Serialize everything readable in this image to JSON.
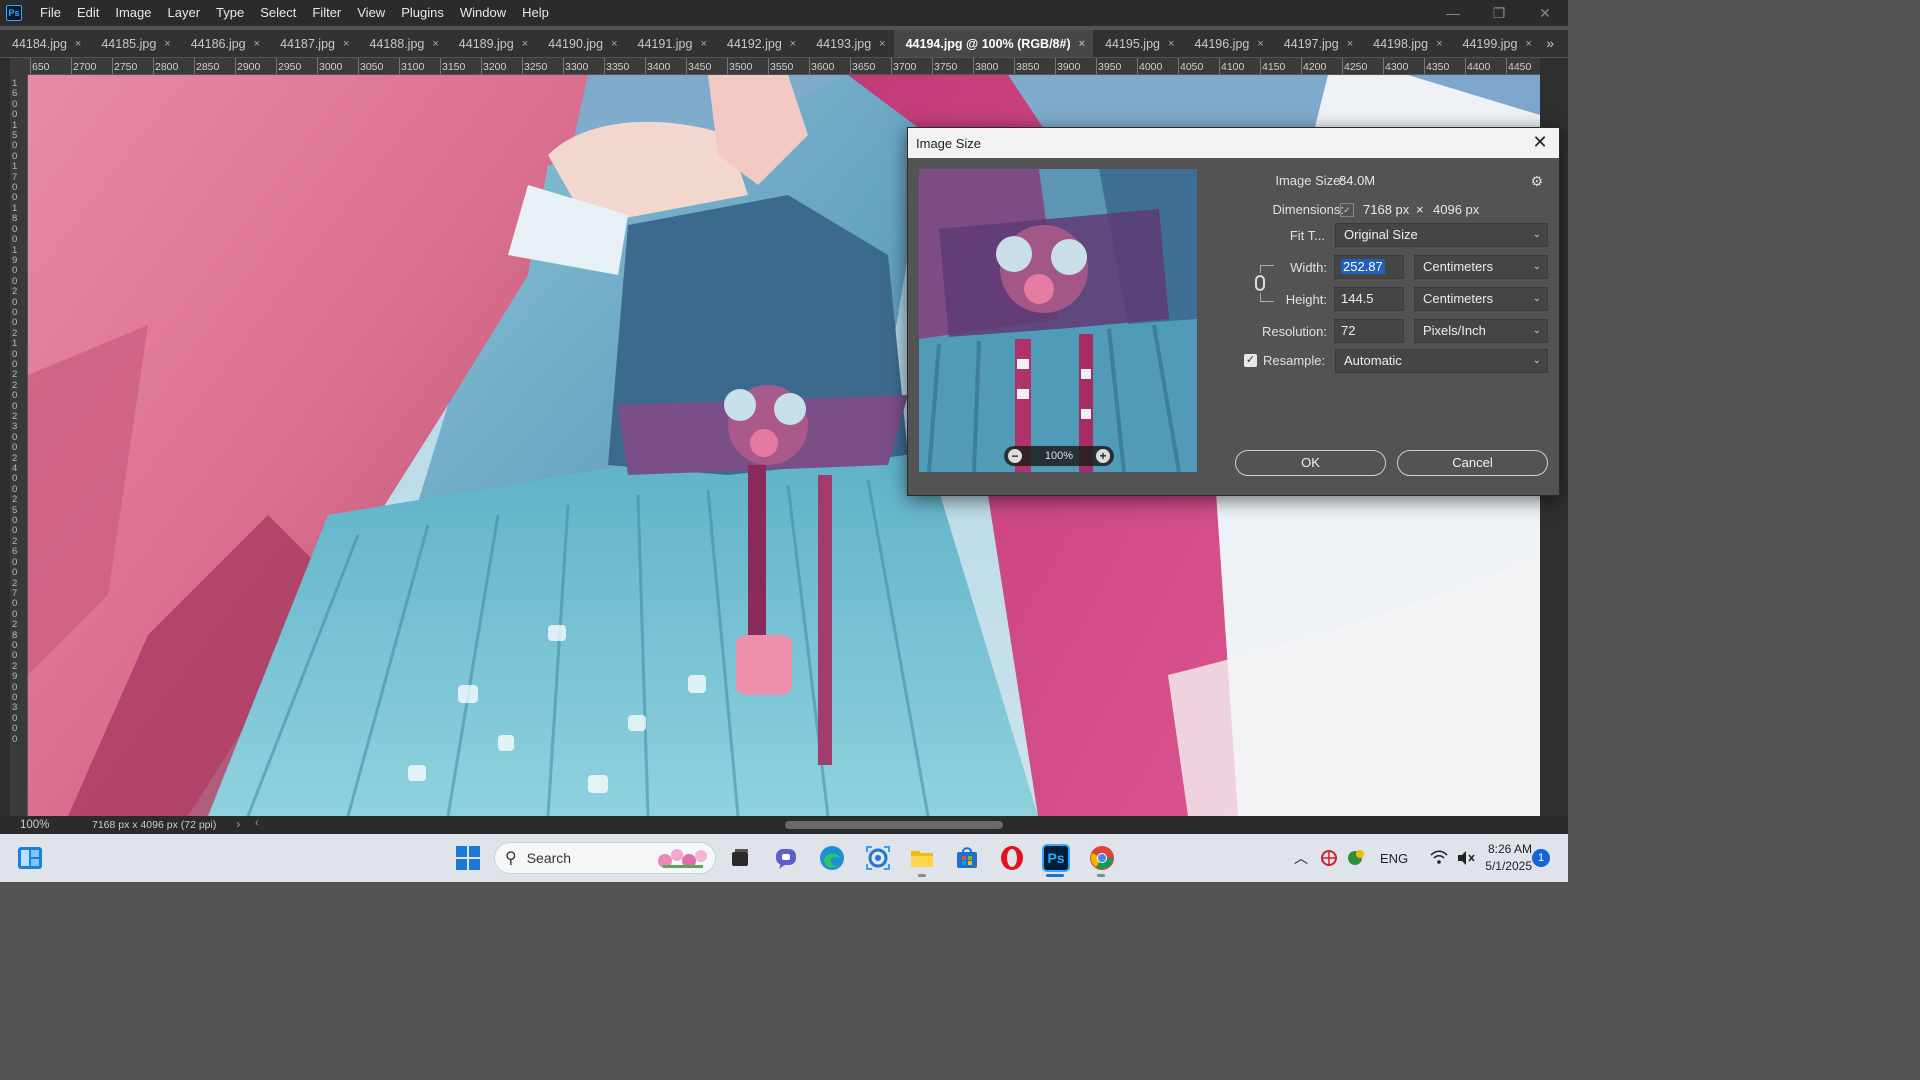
{
  "menu": {
    "logo": "Ps",
    "items": [
      "File",
      "Edit",
      "Image",
      "Layer",
      "Type",
      "Select",
      "Filter",
      "View",
      "Plugins",
      "Window",
      "Help"
    ]
  },
  "tabs": [
    {
      "label": "44184.jpg",
      "active": false
    },
    {
      "label": "44185.jpg",
      "active": false
    },
    {
      "label": "44186.jpg",
      "active": false
    },
    {
      "label": "44187.jpg",
      "active": false
    },
    {
      "label": "44188.jpg",
      "active": false
    },
    {
      "label": "44189.jpg",
      "active": false
    },
    {
      "label": "44190.jpg",
      "active": false
    },
    {
      "label": "44191.jpg",
      "active": false
    },
    {
      "label": "44192.jpg",
      "active": false
    },
    {
      "label": "44193.jpg",
      "active": false
    },
    {
      "label": "44194.jpg @ 100% (RGB/8#)",
      "active": true
    },
    {
      "label": "44195.jpg",
      "active": false
    },
    {
      "label": "44196.jpg",
      "active": false
    },
    {
      "label": "44197.jpg",
      "active": false
    },
    {
      "label": "44198.jpg",
      "active": false
    },
    {
      "label": "44199.jpg",
      "active": false
    }
  ],
  "tab_close_glyph": "×",
  "tab_more_glyph": "»",
  "ruler": {
    "top_labels": [
      "650",
      "2700",
      "2750",
      "2800",
      "2850",
      "2900",
      "2950",
      "3000",
      "3050",
      "3100",
      "3150",
      "3200",
      "3250",
      "3300",
      "3350",
      "3400",
      "3450",
      "3500",
      "3550",
      "3600",
      "3650",
      "3700",
      "3750",
      "3800",
      "3850",
      "3900",
      "3950",
      "4000",
      "4050",
      "4100",
      "4150",
      "4200",
      "4250",
      "4300",
      "4350",
      "4400",
      "4450",
      "4"
    ],
    "left_text": "1600150017001800190020002100220023002400250026002700280029003000"
  },
  "status": {
    "zoom": "100%",
    "dimensions": "7168 px x 4096 px (72 ppi)",
    "arrow": "›",
    "scroll_left": "‹"
  },
  "dialog": {
    "title": "Image Size",
    "close": "✕",
    "preview_zoom": "100%",
    "zoom_minus": "−",
    "zoom_plus": "+",
    "image_size_label": "Image Size:",
    "image_size_value": "84.0M",
    "gear": "⚙",
    "dimensions_label": "Dimensions:",
    "dimensions_toggle": "✓",
    "dim_width": "7168 px",
    "dim_x": "×",
    "dim_height": "4096 px",
    "fit_label": "Fit T...",
    "fit_value": "Original Size",
    "width_label": "Width:",
    "width_value": "252.87",
    "width_unit": "Centimeters",
    "height_label": "Height:",
    "height_value": "144.5",
    "height_unit": "Centimeters",
    "resolution_label": "Resolution:",
    "resolution_value": "72",
    "resolution_unit": "Pixels/Inch",
    "resample_label": "Resample:",
    "resample_checked": "✓",
    "resample_value": "Automatic",
    "ok": "OK",
    "cancel": "Cancel",
    "chevron": "⌄"
  },
  "taskbar": {
    "search_placeholder": "Search",
    "search_icon": "⚲",
    "lang": "ENG",
    "time": "8:26 AM",
    "date": "5/1/2025",
    "notifications": "1",
    "ps_label": "Ps"
  },
  "window_controls": {
    "minimize": "—",
    "maximize": "❐",
    "close": "✕"
  },
  "colors": {
    "accent": "#31a8ff",
    "selection": "#1f5fbf",
    "notif": "#1662d9"
  }
}
